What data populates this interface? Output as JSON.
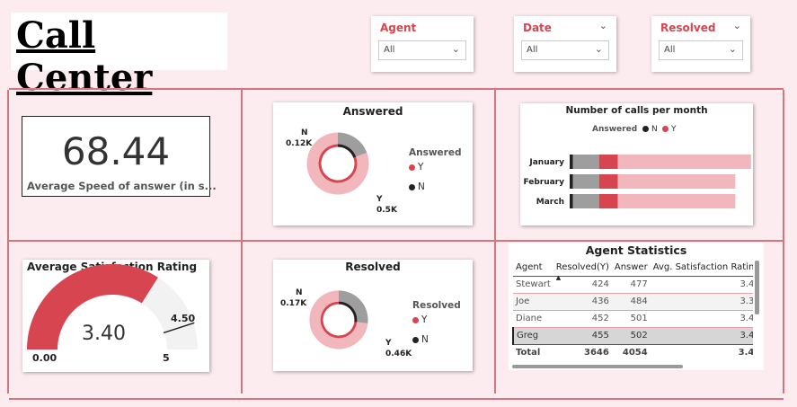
{
  "title": "Call Center",
  "slicers": {
    "agent": {
      "label": "Agent",
      "value": "All"
    },
    "date": {
      "label": "Date",
      "value": "All"
    },
    "resolved": {
      "label": "Resolved",
      "value": "All"
    }
  },
  "kpi": {
    "value": "68.44",
    "label": "Average Speed of answer (in s..."
  },
  "colors": {
    "y": "#d64550",
    "n": "#9e9e9e",
    "accent": "#d9737e",
    "light": "#f2b7bc",
    "dark": "#222222"
  },
  "answered": {
    "title": "Answered",
    "legend_title": "Answered",
    "legend_y": "Y",
    "legend_n": "N",
    "label_n": "N",
    "value_n": "0.12K",
    "label_y": "Y",
    "value_y": "0.5K"
  },
  "resolved": {
    "title": "Resolved",
    "legend_title": "Resolved",
    "legend_y": "Y",
    "legend_n": "N",
    "label_n": "N",
    "value_n": "0.17K",
    "label_y": "Y",
    "value_y": "0.46K"
  },
  "monthly": {
    "title": "Number of calls per month",
    "legend_title": "Answered",
    "legend_n": "N",
    "legend_y": "Y"
  },
  "gauge": {
    "title": "Average Satisfaction Rating",
    "value": "3.40",
    "min": "0.00",
    "max": "5",
    "target": "4.50"
  },
  "agent_stats": {
    "title": "Agent Statistics",
    "columns": [
      "Agent",
      "Resolved(Y)",
      "Answer",
      "Avg. Satisfaction Ratin"
    ],
    "rows": [
      [
        "Stewart",
        "424",
        "477",
        "3.4"
      ],
      [
        "Joe",
        "436",
        "484",
        "3.3"
      ],
      [
        "Diane",
        "452",
        "501",
        "3.4"
      ],
      [
        "Greg",
        "455",
        "502",
        "3.4"
      ]
    ],
    "total": [
      "Total",
      "3646",
      "4054",
      "3.4"
    ]
  },
  "chart_data": [
    {
      "type": "pie",
      "title": "Answered",
      "categories": [
        "N",
        "Y"
      ],
      "values": [
        0.12,
        0.5
      ],
      "unit": "K"
    },
    {
      "type": "pie",
      "title": "Resolved",
      "categories": [
        "N",
        "Y"
      ],
      "values": [
        0.17,
        0.46
      ],
      "unit": "K"
    },
    {
      "type": "bar",
      "title": "Number of calls per month",
      "orientation": "horizontal",
      "stacked": true,
      "categories": [
        "January",
        "February",
        "March"
      ],
      "series": [
        {
          "name": "N",
          "values": [
            25,
            23,
            25
          ]
        },
        {
          "name": "Y",
          "values": [
            145,
            130,
            130
          ]
        }
      ],
      "segments": [
        [
          {
            "color": "#222222",
            "value": 3
          },
          {
            "color": "#9e9e9e",
            "value": 25
          },
          {
            "color": "#d64550",
            "value": 18
          },
          {
            "color": "#f2b7bc",
            "value": 127
          }
        ],
        [
          {
            "color": "#222222",
            "value": 3
          },
          {
            "color": "#9e9e9e",
            "value": 25
          },
          {
            "color": "#d64550",
            "value": 18
          },
          {
            "color": "#f2b7bc",
            "value": 112
          }
        ],
        [
          {
            "color": "#222222",
            "value": 3
          },
          {
            "color": "#9e9e9e",
            "value": 25
          },
          {
            "color": "#d64550",
            "value": 18
          },
          {
            "color": "#f2b7bc",
            "value": 112
          }
        ]
      ],
      "xlim": [
        0,
        180
      ]
    },
    {
      "type": "gauge",
      "title": "Average Satisfaction Rating",
      "value": 3.4,
      "min": 0,
      "max": 5,
      "target": 4.5
    }
  ]
}
